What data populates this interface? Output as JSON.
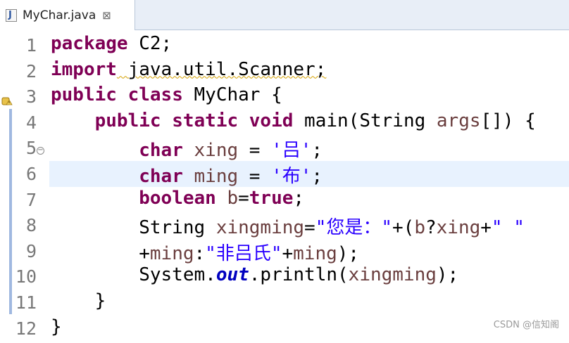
{
  "tab": {
    "title": "MyChar.java",
    "close_symbol": "⊠",
    "icon": "java-file-icon"
  },
  "line_numbers": [
    "1",
    "2",
    "3",
    "4",
    "5",
    "6",
    "7",
    "8",
    "9",
    "10",
    "11",
    "12"
  ],
  "active_line": 6,
  "code": [
    {
      "p": "kw",
      "t": "package"
    },
    {
      "p": "pl",
      "t": " C2;"
    },
    {
      "p": "kw",
      "t": "import"
    },
    {
      "p": "pl",
      "t": " java.util.Scanner;"
    },
    {
      "p": "kw",
      "t": "public"
    },
    {
      "p": "pl",
      "t": " "
    },
    {
      "p": "kw",
      "t": "class"
    },
    {
      "p": "pl",
      "t": " MyChar {"
    },
    {
      "p": "pl",
      "t": "    "
    },
    {
      "p": "kw",
      "t": "public"
    },
    {
      "p": "pl",
      "t": " "
    },
    {
      "p": "kw",
      "t": "static"
    },
    {
      "p": "pl",
      "t": " "
    },
    {
      "p": "kw",
      "t": "void"
    },
    {
      "p": "pl",
      "t": " main(String "
    },
    {
      "p": "var",
      "t": "args"
    },
    {
      "p": "pl",
      "t": "[]) {"
    },
    {
      "p": "pl",
      "t": "        "
    },
    {
      "p": "kw",
      "t": "char"
    },
    {
      "p": "pl",
      "t": " "
    },
    {
      "p": "var",
      "t": "xing"
    },
    {
      "p": "pl",
      "t": " = "
    },
    {
      "p": "str",
      "t": "'吕'"
    },
    {
      "p": "pl",
      "t": ";"
    },
    {
      "p": "pl",
      "t": "        "
    },
    {
      "p": "kw",
      "t": "char"
    },
    {
      "p": "pl",
      "t": " "
    },
    {
      "p": "var",
      "t": "ming"
    },
    {
      "p": "pl",
      "t": " = "
    },
    {
      "p": "str",
      "t": "'布'"
    },
    {
      "p": "pl",
      "t": ";"
    },
    {
      "p": "pl",
      "t": "        "
    },
    {
      "p": "kw",
      "t": "boolean"
    },
    {
      "p": "pl",
      "t": " "
    },
    {
      "p": "var",
      "t": "b"
    },
    {
      "p": "pl",
      "t": "="
    },
    {
      "p": "kw",
      "t": "true"
    },
    {
      "p": "pl",
      "t": ";"
    },
    {
      "p": "pl",
      "t": "        String "
    },
    {
      "p": "var",
      "t": "xingming"
    },
    {
      "p": "pl",
      "t": "="
    },
    {
      "p": "str",
      "t": "\"您是：\""
    },
    {
      "p": "pl",
      "t": "+("
    },
    {
      "p": "var",
      "t": "b"
    },
    {
      "p": "pl",
      "t": "?"
    },
    {
      "p": "var",
      "t": "xing"
    },
    {
      "p": "pl",
      "t": "+"
    },
    {
      "p": "str",
      "t": "\" \""
    },
    {
      "p": "pl",
      "t": "        +"
    },
    {
      "p": "var",
      "t": "ming"
    },
    {
      "p": "pl",
      "t": ":"
    },
    {
      "p": "str",
      "t": "\"非吕氏\""
    },
    {
      "p": "pl",
      "t": "+"
    },
    {
      "p": "var",
      "t": "ming"
    },
    {
      "p": "pl",
      "t": ");"
    },
    {
      "p": "pl",
      "t": "        System."
    },
    {
      "p": "fld",
      "t": "out"
    },
    {
      "p": "pl",
      "t": ".println("
    },
    {
      "p": "var",
      "t": "xingming"
    },
    {
      "p": "pl",
      "t": ");"
    },
    {
      "p": "pl",
      "t": "    }"
    },
    {
      "p": "pl",
      "t": "}"
    }
  ],
  "watermark": "CSDN @信知阁",
  "colors": {
    "keyword": "#7f0055",
    "string": "#2a00ff",
    "variable": "#6a3e3e",
    "static_field": "#0000c0",
    "active_line": "#e8f2fe",
    "quick_diff": "#a0b8e0"
  }
}
